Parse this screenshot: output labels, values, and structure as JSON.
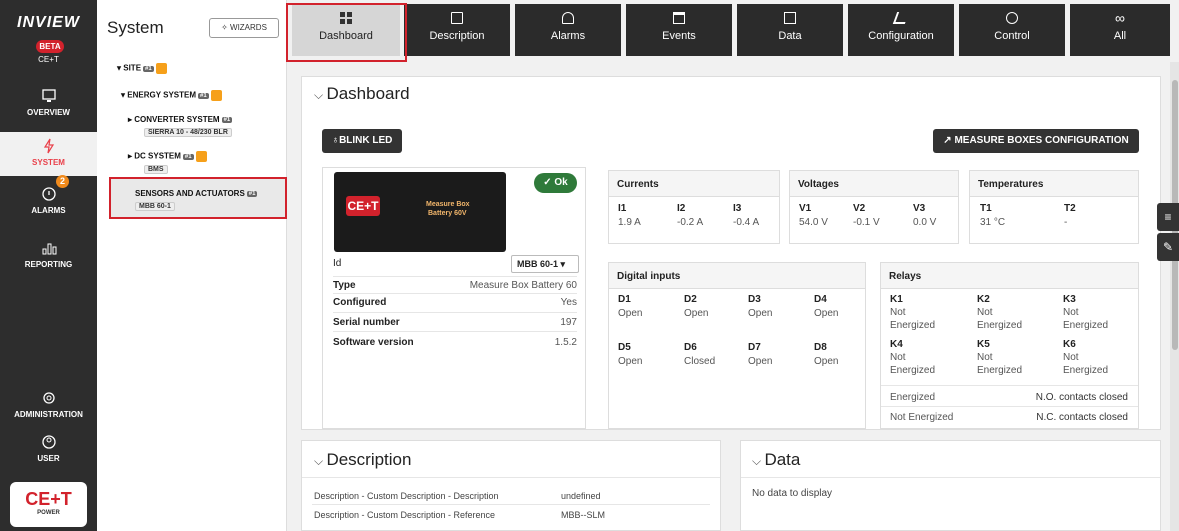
{
  "rail": {
    "brand": "INVIEW",
    "beta": "BETA",
    "cet": "CE+T",
    "items": [
      {
        "label": "OVERVIEW",
        "icon": "monitor-icon"
      },
      {
        "label": "SYSTEM",
        "icon": "bolt-icon"
      },
      {
        "label": "ALARMS",
        "icon": "bell-icon",
        "badge": "2"
      },
      {
        "label": "REPORTING",
        "icon": "bars-icon"
      },
      {
        "label": "ADMINISTRATION",
        "icon": "gear-icon"
      },
      {
        "label": "USER",
        "icon": "user-icon"
      }
    ],
    "logo_text": "CE+T",
    "logo_sub": "POWER"
  },
  "tree": {
    "title": "System",
    "wizards": "WIZARDS",
    "site": "SITE",
    "energy": "ENERGY SYSTEM",
    "converter": "CONVERTER SYSTEM",
    "converter_sub": "SIERRA 10 - 48/230 BLR",
    "dc": "DC SYSTEM",
    "dc_sub": "BMS",
    "sensors": "SENSORS AND ACTUATORS",
    "sensors_sub": "MBB 60-1",
    "tag": "#1"
  },
  "tabs": [
    "Dashboard",
    "Description",
    "Alarms",
    "Events",
    "Data",
    "Configuration",
    "Control",
    "All"
  ],
  "main": {
    "title": "Dashboard",
    "blink": "BLINK LED",
    "measure": "MEASURE BOXES CONFIGURATION",
    "status": "Ok",
    "device_title": "Measure Box",
    "device_sub": "Battery 60V",
    "id_label": "Id",
    "id_value": "MBB 60-1",
    "props": [
      {
        "k": "Type",
        "v": "Measure Box Battery 60"
      },
      {
        "k": "Configured",
        "v": "Yes"
      },
      {
        "k": "Serial number",
        "v": "197"
      },
      {
        "k": "Software version",
        "v": "1.5.2"
      }
    ],
    "currents": {
      "title": "Currents",
      "cols": [
        {
          "k": "I1",
          "v": "1.9 A"
        },
        {
          "k": "I2",
          "v": "-0.2 A"
        },
        {
          "k": "I3",
          "v": "-0.4 A"
        }
      ]
    },
    "voltages": {
      "title": "Voltages",
      "cols": [
        {
          "k": "V1",
          "v": "54.0 V"
        },
        {
          "k": "V2",
          "v": "-0.1 V"
        },
        {
          "k": "V3",
          "v": "0.0 V"
        }
      ]
    },
    "temperatures": {
      "title": "Temperatures",
      "cols": [
        {
          "k": "T1",
          "v": "31 °C"
        },
        {
          "k": "T2",
          "v": "-"
        }
      ]
    },
    "digital": {
      "title": "Digital inputs",
      "items": [
        {
          "k": "D1",
          "v": "Open"
        },
        {
          "k": "D2",
          "v": "Open"
        },
        {
          "k": "D3",
          "v": "Open"
        },
        {
          "k": "D4",
          "v": "Open"
        },
        {
          "k": "D5",
          "v": "Open"
        },
        {
          "k": "D6",
          "v": "Closed"
        },
        {
          "k": "D7",
          "v": "Open"
        },
        {
          "k": "D8",
          "v": "Open"
        }
      ]
    },
    "relays": {
      "title": "Relays",
      "items": [
        {
          "k": "K1",
          "v1": "Not",
          "v2": "Energized"
        },
        {
          "k": "K2",
          "v1": "Not",
          "v2": "Energized"
        },
        {
          "k": "K3",
          "v1": "Not",
          "v2": "Energized"
        },
        {
          "k": "K4",
          "v1": "Not",
          "v2": "Energized"
        },
        {
          "k": "K5",
          "v1": "Not",
          "v2": "Energized"
        },
        {
          "k": "K6",
          "v1": "Not",
          "v2": "Energized"
        }
      ],
      "legend": [
        {
          "k": "Energized",
          "v": "N.O. contacts closed"
        },
        {
          "k": "Not Energized",
          "v": "N.C. contacts closed"
        }
      ]
    }
  },
  "description": {
    "title": "Description",
    "rows": [
      {
        "k": "Description - Custom Description - Description",
        "v": "undefined"
      },
      {
        "k": "Description - Custom Description - Reference",
        "v": "MBB--SLM"
      }
    ]
  },
  "data": {
    "title": "Data",
    "empty": "No data to display"
  }
}
